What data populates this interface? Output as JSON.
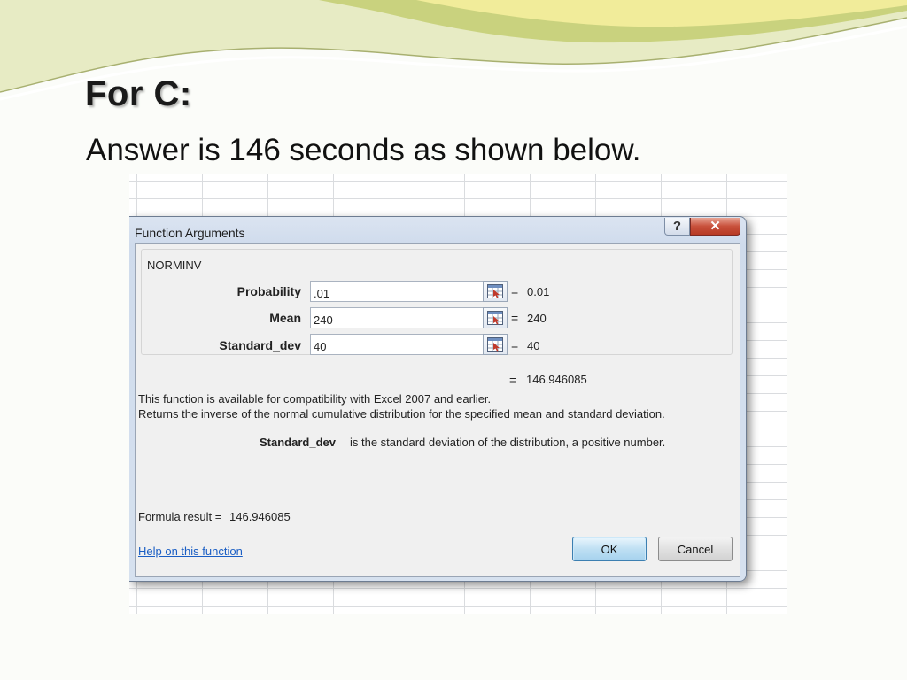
{
  "slide": {
    "title": "For C:",
    "subtitle": "Answer is 146 seconds as shown below."
  },
  "dialog": {
    "title": "Function Arguments",
    "help_glyph": "?",
    "close_glyph": "✕",
    "function_name": "NORMINV",
    "arguments": [
      {
        "label": "Probability",
        "value": ".01",
        "result": "0.01",
        "ref_icon": "collapse-dialog-icon"
      },
      {
        "label": "Mean",
        "value": "240",
        "result": "240",
        "ref_icon": "collapse-dialog-icon"
      },
      {
        "label": "Standard_dev",
        "value": "40",
        "result": "40",
        "ref_icon": "collapse-dialog-icon"
      }
    ],
    "equals": "=",
    "total_result": "146.946085",
    "compat_note": "This function is available for compatibility with Excel 2007 and earlier.",
    "description": "Returns the inverse of the normal cumulative distribution for the specified mean and standard deviation.",
    "param_name": "Standard_dev",
    "param_description": "is the standard deviation of the distribution, a positive number.",
    "formula_result_label": "Formula result =",
    "formula_result_value": "146.946085",
    "help_link": "Help on this function",
    "ok_label": "OK",
    "cancel_label": "Cancel"
  },
  "colors": {
    "close_button": "#c8503b",
    "ok_button_border": "#3c7fb1",
    "link": "#1a5ec4",
    "deco_green": "#c9d27e",
    "deco_yellow": "#f1ec9a"
  }
}
